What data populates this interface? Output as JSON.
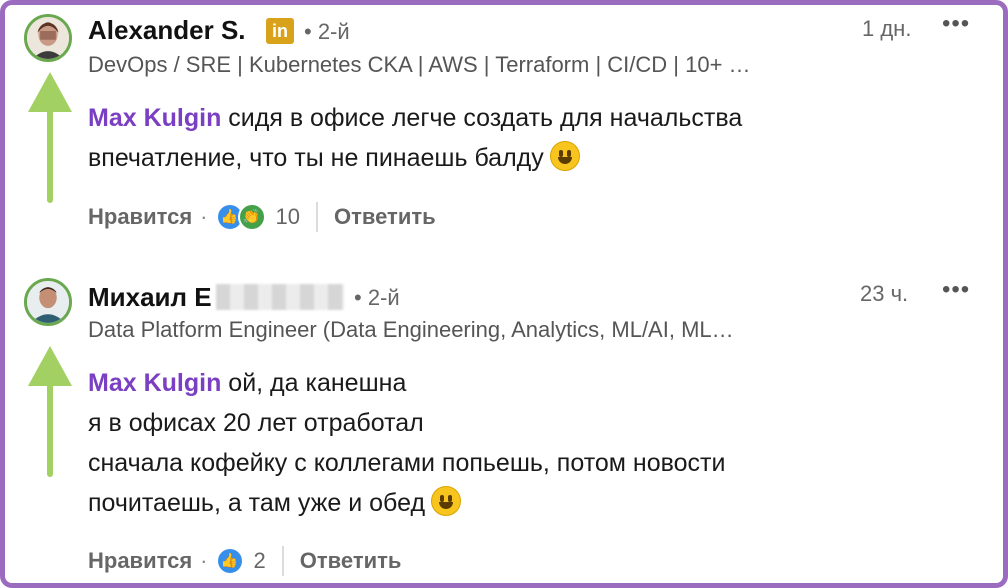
{
  "colors": {
    "frame": "#9b6bbf",
    "mention": "#7a3fc2",
    "arrow": "#a3d063"
  },
  "comments": [
    {
      "author": "Alexander S.",
      "badge": "in",
      "degree": "• 2-й",
      "time": "1 дн.",
      "more": "•••",
      "headline": "DevOps / SRE | Kubernetes CKA | AWS | Terraform | CI/CD | 10+ …",
      "mention": "Max Kulgin",
      "lines": [
        " сидя в офисе легче создать для начальства",
        "впечатление, что ты не пинаешь балду"
      ],
      "like_label": "Нравится",
      "dot": "·",
      "reaction_count": "10",
      "reply_label": "Ответить",
      "emoji": "smiling-face-icon",
      "reactions": [
        "like-icon",
        "celebrate-icon"
      ]
    },
    {
      "author": "Михаил Е",
      "degree": "• 2-й",
      "time": "23 ч.",
      "more": "•••",
      "headline": "Data Platform Engineer (Data Engineering, Analytics, ML/AI, ML…",
      "mention": "Max Kulgin",
      "lines": [
        " ой, да канешна",
        "я в офисах 20 лет отработал",
        "сначала кофейку с коллегами попьешь, потом новости",
        "почитаешь, а там уже и обед"
      ],
      "like_label": "Нравится",
      "dot": "·",
      "reaction_count": "2",
      "reply_label": "Ответить",
      "emoji": "rolling-laughing-face-icon",
      "reactions": [
        "like-icon"
      ]
    }
  ]
}
